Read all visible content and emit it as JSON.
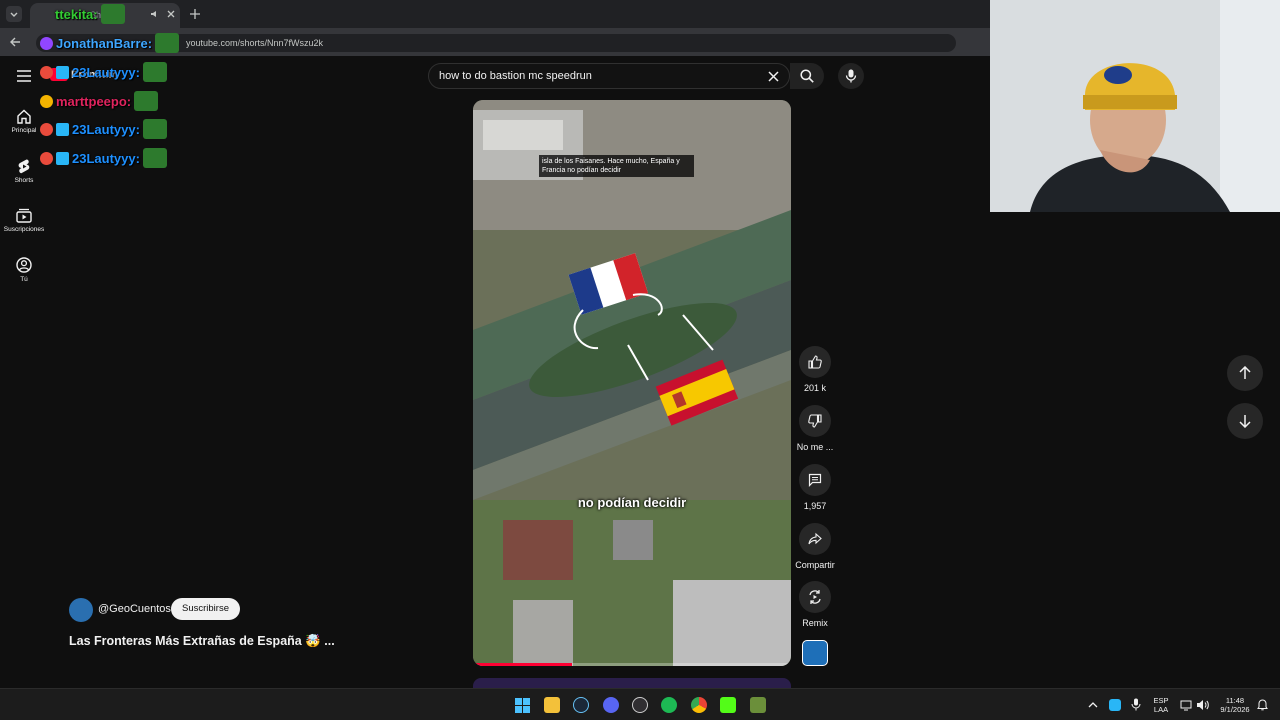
{
  "browser": {
    "tab_title": "Shorts",
    "url": "youtube.com/shorts/Nnn7fWszu2k"
  },
  "header": {
    "brand": "Premium",
    "search_query": "how to do bastion mc speedrun"
  },
  "sidebar": {
    "items": [
      {
        "label": "Principal",
        "icon": "home-icon"
      },
      {
        "label": "Shorts",
        "icon": "shorts-icon"
      },
      {
        "label": "Suscripciones",
        "icon": "subscriptions-icon"
      },
      {
        "label": "Tú",
        "icon": "you-icon"
      }
    ]
  },
  "video": {
    "label_card": "isla de los Faisanes. Hace mucho, España y Francia no podían decidir",
    "caption": "no podían decidir",
    "progress": 0.31
  },
  "actions": {
    "like_count": "201 k",
    "dislike_label": "No me ...",
    "comment_count": "1,957",
    "share_label": "Compartir",
    "remix_label": "Remix"
  },
  "channel": {
    "handle": "@GeoCuentos",
    "subscribe_label": "Suscribirse",
    "title": "Las Fronteras Más Extrañas de España 🤯 ..."
  },
  "chat": [
    {
      "user": "ttekita:",
      "color": "#33cc33"
    },
    {
      "user": "JonathanBarre:",
      "color": "#3ea6ff"
    },
    {
      "user": "23Lautyyy:",
      "color": "#1e90ff"
    },
    {
      "user": "marttpeepo:",
      "color": "#e0245e"
    },
    {
      "user": "23Lautyyy:",
      "color": "#1e90ff"
    },
    {
      "user": "23Lautyyy:",
      "color": "#1e90ff"
    }
  ],
  "taskbar": {
    "lang_top": "ESP",
    "lang_bottom": "LAA",
    "time": "11:48",
    "date": "9/1/2026"
  },
  "colors": {
    "accent": "#ff0033",
    "background": "#0f0f0f"
  }
}
